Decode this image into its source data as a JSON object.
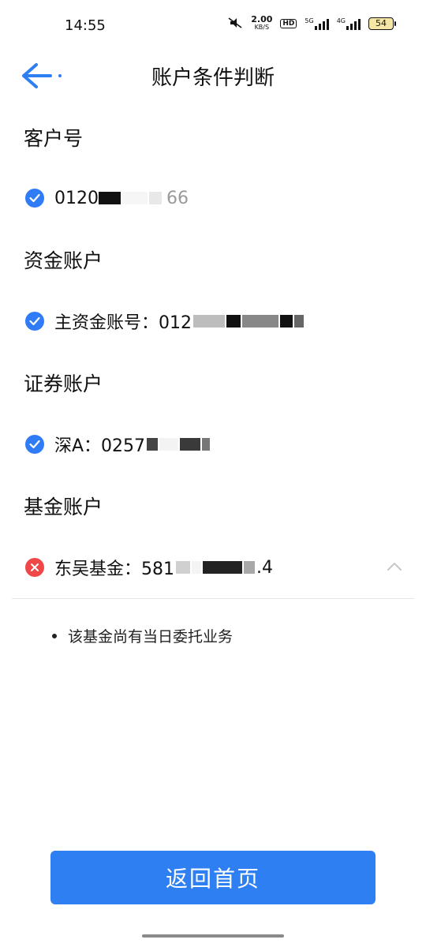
{
  "status_bar": {
    "time": "14:55",
    "net_speed_value": "2.00",
    "net_speed_unit": "KB/S",
    "hd_label": "HD",
    "sim1_label": "5G",
    "sim2_label": "4G",
    "battery": "54"
  },
  "header": {
    "title": "账户条件判断"
  },
  "sections": {
    "customer": {
      "title": "客户号",
      "value": "0120",
      "value_tail": "66",
      "status": "ok"
    },
    "fund_account": {
      "title": "资金账户",
      "value": "主资金账号：012",
      "status": "ok"
    },
    "securities": {
      "title": "证券账户",
      "value": "深A：0257",
      "status": "ok"
    },
    "fund": {
      "title": "基金账户",
      "value": "东吴基金：581",
      "value_tail": ".4",
      "status": "error"
    }
  },
  "fund_note": "该基金尚有当日委托业务",
  "footer": {
    "home_button": "返回首页"
  },
  "colors": {
    "accent": "#2d7ff2",
    "check": "#2f7cf6",
    "error": "#f04848"
  }
}
